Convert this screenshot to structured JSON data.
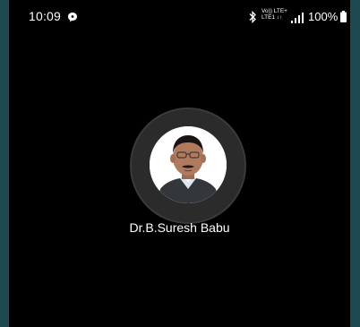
{
  "status_bar": {
    "time": "10:09",
    "network_line1": "Vo)) LTE+",
    "network_line2": "LTE1 ↓↑",
    "battery_percent": "100%"
  },
  "contact": {
    "name": "Dr.B.Suresh Babu"
  },
  "icons": [
    "message-icon",
    "bluetooth-icon",
    "signal-icon",
    "battery-icon",
    "contact-photo"
  ],
  "colors": {
    "background": "#000000",
    "frame": "#1f4950",
    "ring": "#2b2b2b",
    "text": "#ffffff"
  }
}
